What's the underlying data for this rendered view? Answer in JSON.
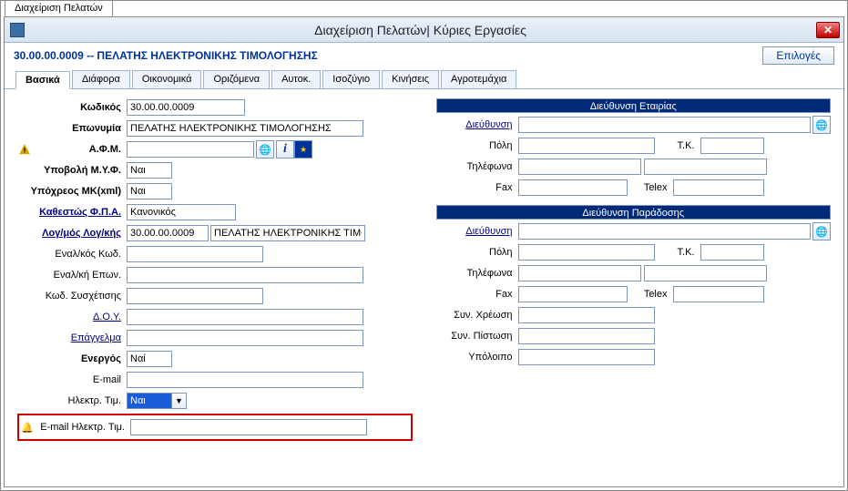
{
  "outerTab": "Διαχείριση Πελατών",
  "title": "Διαχείριση Πελατών| Κύριες Εργασίες",
  "recordTitle": "30.00.00.0009 -- ΠΕΛΑΤΗΣ ΗΛΕΚΤΡΟΝΙΚΗΣ ΤΙΜΟΛΟΓΗΣΗΣ",
  "optionsLabel": "Επιλογές",
  "tabs": [
    "Βασικά",
    "Διάφορα",
    "Οικονομικά",
    "Οριζόμενα",
    "Αυτοκ.",
    "Ισοζύγιο",
    "Κινήσεις",
    "Αγροτεμάχια"
  ],
  "left": {
    "kodikos": {
      "label": "Κωδικός",
      "value": "30.00.00.0009"
    },
    "eponymia": {
      "label": "Επωνυμία",
      "value": "ΠΕΛΑΤΗΣ ΗΛΕΚΤΡΟΝΙΚΗΣ ΤΙΜΟΛΟΓΗΣΗΣ"
    },
    "afm": {
      "label": "Α.Φ.Μ.",
      "value": ""
    },
    "ypovoli": {
      "label": "Υποβολή Μ.Υ.Φ.",
      "value": "Ναι"
    },
    "ypoxreos": {
      "label": "Υπόχρεος MK(xml)",
      "value": "Ναι"
    },
    "kathestos": {
      "label": "Καθεστώς Φ.Π.Α.",
      "value": "Κανονικός"
    },
    "logmos": {
      "label": "Λογ/μός Λογ/κής",
      "code": "30.00.00.0009",
      "desc": "ΠΕΛΑΤΗΣ ΗΛΕΚΤΡΟΝΙΚΗΣ ΤΙΜΟΛΟ"
    },
    "enalkod": {
      "label": "Εναλ/κός Κωδ.",
      "value": ""
    },
    "enalepon": {
      "label": "Εναλ/κή Επων.",
      "value": ""
    },
    "kodsysx": {
      "label": "Κωδ. Συσχέτισης",
      "value": ""
    },
    "doy": {
      "label": "Δ.Ο.Υ.",
      "value": ""
    },
    "epaggelma": {
      "label": "Επάγγελμα",
      "value": ""
    },
    "energos": {
      "label": "Ενεργός",
      "value": "Ναί"
    },
    "email": {
      "label": "E-mail",
      "value": ""
    },
    "ilektrTim": {
      "label": "Ηλεκτρ. Τιμ.",
      "value": "Ναι"
    },
    "emailIlektr": {
      "label": "E-mail Ηλεκτρ. Τιμ.",
      "value": ""
    }
  },
  "right": {
    "section1": "Διεύθυνση Εταιρίας",
    "s1": {
      "dieuthinsi": {
        "label": "Διεύθυνση",
        "value": ""
      },
      "poli": {
        "label": "Πόλη",
        "value": ""
      },
      "tk": {
        "label": "Τ.Κ.",
        "value": ""
      },
      "tilefona": {
        "label": "Τηλέφωνα",
        "value1": "",
        "value2": ""
      },
      "fax": {
        "label": "Fax",
        "value": ""
      },
      "telex": {
        "label": "Telex",
        "value": ""
      }
    },
    "section2": "Διεύθυνση Παράδοσης",
    "s2": {
      "dieuthinsi": {
        "label": "Διεύθυνση",
        "value": ""
      },
      "poli": {
        "label": "Πόλη",
        "value": ""
      },
      "tk": {
        "label": "Τ.Κ.",
        "value": ""
      },
      "tilefona": {
        "label": "Τηλέφωνα",
        "value1": "",
        "value2": ""
      },
      "fax": {
        "label": "Fax",
        "value": ""
      },
      "telex": {
        "label": "Telex",
        "value": ""
      },
      "synxreosi": {
        "label": "Συν. Χρέωση",
        "value": ""
      },
      "synpistosi": {
        "label": "Συν. Πίστωση",
        "value": ""
      },
      "ypoloipo": {
        "label": "Υπόλοιπο",
        "value": ""
      }
    }
  }
}
